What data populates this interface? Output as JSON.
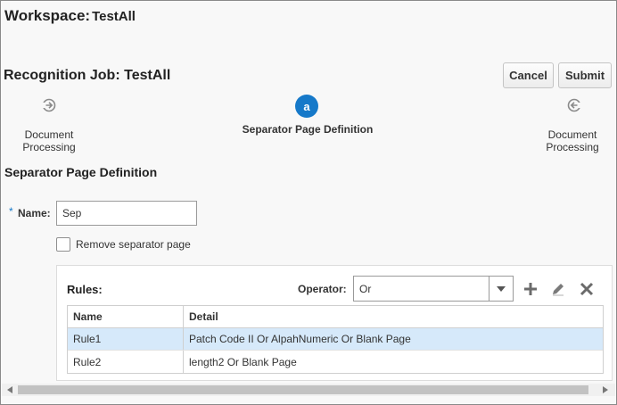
{
  "workspace": {
    "label": "Workspace:",
    "name": "TestAll"
  },
  "job": {
    "title": "Recognition Job: TestAll"
  },
  "buttons": {
    "cancel": "Cancel",
    "submit": "Submit"
  },
  "train": {
    "previous": {
      "icon": "previous-step-icon",
      "label_line1": "Document",
      "label_line2": "Processing"
    },
    "current": {
      "glyph": "a",
      "label": "Separator Page Definition"
    },
    "next": {
      "icon": "next-step-icon",
      "label_line1": "Document",
      "label_line2": "Processing"
    }
  },
  "section": {
    "title": "Separator Page Definition"
  },
  "form": {
    "required_mark": "*",
    "name_label": "Name:",
    "name_value": "Sep",
    "remove_separator_label": "Remove separator page",
    "remove_separator_checked": false
  },
  "rules": {
    "label": "Rules:",
    "operator_label": "Operator:",
    "operator_value": "Or",
    "columns": [
      "Name",
      "Detail"
    ],
    "rows": [
      {
        "name": "Rule1",
        "detail": "Patch Code II Or AlpahNumeric Or Blank Page",
        "selected": true
      },
      {
        "name": "Rule2",
        "detail": "length2 Or Blank Page",
        "selected": false
      }
    ]
  },
  "colors": {
    "accent": "#1679c9",
    "selected_row": "#d6e9fa"
  }
}
